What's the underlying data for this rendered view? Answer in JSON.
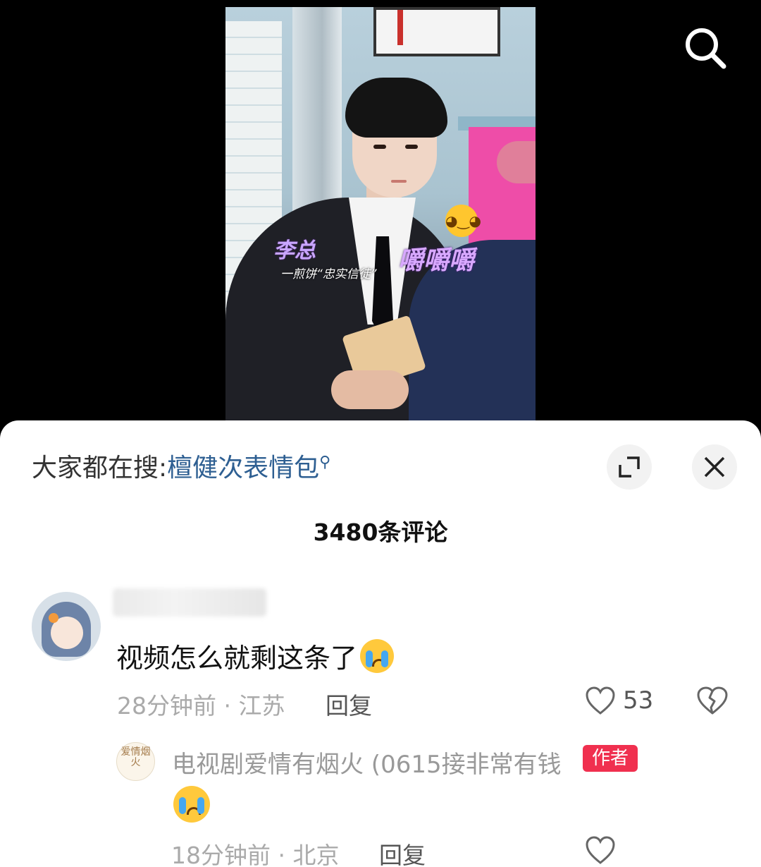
{
  "video": {
    "caption_name": "李总",
    "caption_sub": "一煎饼“忠实信徒”",
    "caption_chew": "嚼嚼嚼",
    "emoji": "wink-emoji",
    "background_colors": {
      "pink": "#ee4da8",
      "caption_purple": "#c9a6ff"
    }
  },
  "top_bar": {
    "search_icon": "search-icon"
  },
  "sheet": {
    "hot_search_prefix": "大家都在搜:",
    "hot_search_term": "檀健次表情包",
    "hot_search_icon": "search-icon",
    "expand_icon": "expand-icon",
    "close_icon": "close-icon",
    "comment_count": "3480条评论"
  },
  "comments": [
    {
      "text": "视频怎么就剩这条了",
      "emoji": "crying-emoji",
      "meta": "28分钟前 · 江苏",
      "reply_label": "回复",
      "likes": "53"
    }
  ],
  "replies": [
    {
      "author": "电视剧爱情有烟火 (0615接非常有钱",
      "avatar_text": "爱情烟火",
      "badge": "作者",
      "emoji": "crying-emoji",
      "meta": "18分钟前 · 北京",
      "reply_label": "回复"
    }
  ],
  "colors": {
    "link_blue": "#2e5f92",
    "author_badge": "#f0304f"
  }
}
